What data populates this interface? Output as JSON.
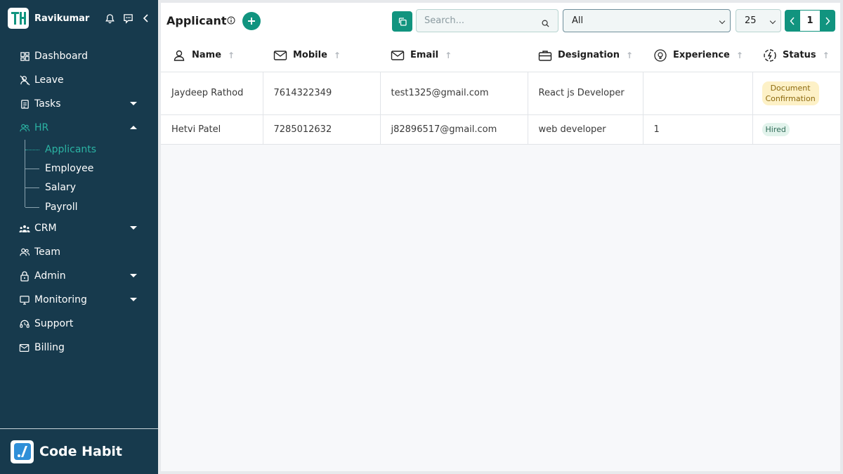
{
  "user": {
    "name": "Ravikumar",
    "logo_text": "TH"
  },
  "nav": {
    "items": [
      {
        "label": "Dashboard",
        "icon": "dashboard-icon"
      },
      {
        "label": "Leave",
        "icon": "leave-icon"
      },
      {
        "label": "Tasks",
        "icon": "tasks-icon"
      },
      {
        "label": "HR",
        "icon": "hr-icon"
      },
      {
        "label": "CRM",
        "icon": "crm-icon"
      },
      {
        "label": "Team",
        "icon": "team-icon"
      },
      {
        "label": "Admin",
        "icon": "lock-icon"
      },
      {
        "label": "Monitoring",
        "icon": "monitor-icon"
      },
      {
        "label": "Support",
        "icon": "headset-icon"
      },
      {
        "label": "Billing",
        "icon": "billing-icon"
      }
    ],
    "hr_sub": [
      "Applicants",
      "Employee",
      "Salary",
      "Payroll"
    ]
  },
  "footer": {
    "brand": "Code Habit"
  },
  "page": {
    "title": "Applicant",
    "search_placeholder": "Search...",
    "filter_value": "All",
    "per_page": "25",
    "current_page": "1"
  },
  "table": {
    "columns": [
      "Name",
      "Mobile",
      "Email",
      "Designation",
      "Experience",
      "Status"
    ],
    "rows": [
      {
        "name": "Jaydeep Rathod",
        "mobile": "7614322349",
        "email": "test1325@gmail.com",
        "designation": "React js Developer",
        "experience": "",
        "status_line1": "Document",
        "status_line2": "Confirmation"
      },
      {
        "name": "Hetvi Patel",
        "mobile": "7285012632",
        "email": "j82896517@gmail.com",
        "designation": "web developer",
        "experience": "1",
        "status": "Hired"
      }
    ]
  },
  "colors": {
    "sidebar_bg": "#173a4d",
    "accent": "#11947f",
    "active_text": "#2bb3a3"
  }
}
